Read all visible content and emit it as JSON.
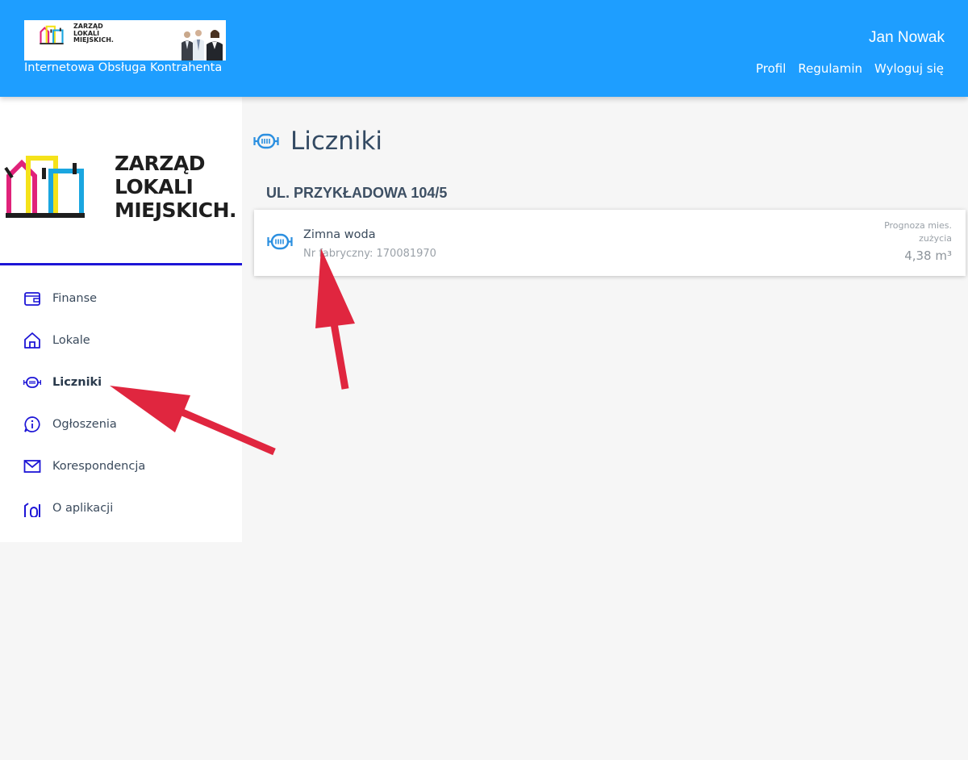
{
  "header": {
    "banner_brand": [
      "ZARZĄD",
      "LOKALI",
      "MIEJSKICH."
    ],
    "subtitle": "Internetowa Obsługa Kontrahenta",
    "user_name": "Jan Nowak",
    "nav": [
      "Profil",
      "Regulamin",
      "Wyloguj się"
    ]
  },
  "sidebar": {
    "brand": [
      "ZARZĄD",
      "LOKALI",
      "MIEJSKICH."
    ],
    "items": [
      {
        "label": "Finanse",
        "icon": "wallet-icon"
      },
      {
        "label": "Lokale",
        "icon": "home-icon"
      },
      {
        "label": "Liczniki",
        "icon": "meter-icon",
        "active": true
      },
      {
        "label": "Ogłoszenia",
        "icon": "info-icon"
      },
      {
        "label": "Korespondencja",
        "icon": "envelope-icon"
      },
      {
        "label": "O aplikacji",
        "icon": "app-info-icon"
      }
    ]
  },
  "main": {
    "title": "Liczniki",
    "address": "UL. PRZYKŁADOWA 104/5",
    "meter": {
      "name": "Zimna woda",
      "serial": "Nr fabryczny: 170081970",
      "forecast_label": "Prognoza mies. zużycia",
      "forecast_value": "4,38 m³"
    }
  },
  "colors": {
    "header_bg": "#1e9eff",
    "sidebar_accent": "#1d15d6",
    "meter_icon": "#2b8fe0",
    "annotation_arrow": "#e0263f"
  }
}
